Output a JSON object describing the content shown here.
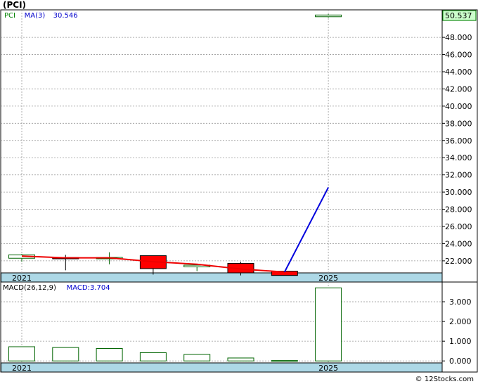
{
  "title": "(PCI)",
  "watermark": "© 12Stocks.com",
  "chart_data": [
    {
      "type": "candlestick",
      "legend": [
        {
          "label": "PCI",
          "color": "#008000"
        },
        {
          "label": "MA(3)",
          "color": "#0000cc"
        },
        {
          "label": "30.546",
          "color": "#0000cc"
        }
      ],
      "last_price": "50.537",
      "ylim": [
        20.6,
        51.2
      ],
      "yticks": [
        "22.000",
        "24.000",
        "26.000",
        "28.000",
        "30.000",
        "32.000",
        "34.000",
        "36.000",
        "38.000",
        "40.000",
        "42.000",
        "44.000",
        "46.000",
        "48.000"
      ],
      "xticks": [
        {
          "label": "2021",
          "index": 0
        },
        {
          "label": "2025",
          "index": 7
        }
      ],
      "candles": [
        {
          "open": 22.3,
          "close": 22.7,
          "high": 22.8,
          "low": 21.9
        },
        {
          "open": 22.4,
          "close": 22.3,
          "high": 22.7,
          "low": 20.9
        },
        {
          "open": 22.3,
          "close": 22.4,
          "high": 23.0,
          "low": 21.6
        },
        {
          "open": 22.6,
          "close": 21.1,
          "high": 22.6,
          "low": 20.4
        },
        {
          "open": 21.3,
          "close": 21.5,
          "high": 21.6,
          "low": 20.8
        },
        {
          "open": 21.7,
          "close": 20.6,
          "high": 21.9,
          "low": 20.3
        },
        {
          "open": 20.8,
          "close": 20.3,
          "high": 20.8,
          "low": 20.3
        },
        {
          "open": 50.4,
          "close": 50.6,
          "high": 50.7,
          "low": 50.3
        }
      ],
      "ma_red": [
        22.55,
        22.35,
        22.35,
        21.9,
        21.6,
        21.05,
        20.7
      ],
      "ma_blue": [
        {
          "i": 6,
          "v": 20.7
        },
        {
          "i": 7,
          "v": 30.546
        }
      ]
    },
    {
      "type": "bar",
      "legend": [
        {
          "label": "MACD(26,12,9)",
          "color": "#000000"
        },
        {
          "label": "MACD:3.704",
          "color": "#0000cc"
        }
      ],
      "ylim": [
        -0.1,
        4.0
      ],
      "yticks": [
        "0.000",
        "1.000",
        "2.000",
        "3.000"
      ],
      "xticks": [
        {
          "label": "2021",
          "index": 0
        },
        {
          "label": "2025",
          "index": 7
        }
      ],
      "values": [
        0.72,
        0.68,
        0.63,
        0.42,
        0.33,
        0.15,
        0.02,
        3.704
      ]
    }
  ]
}
